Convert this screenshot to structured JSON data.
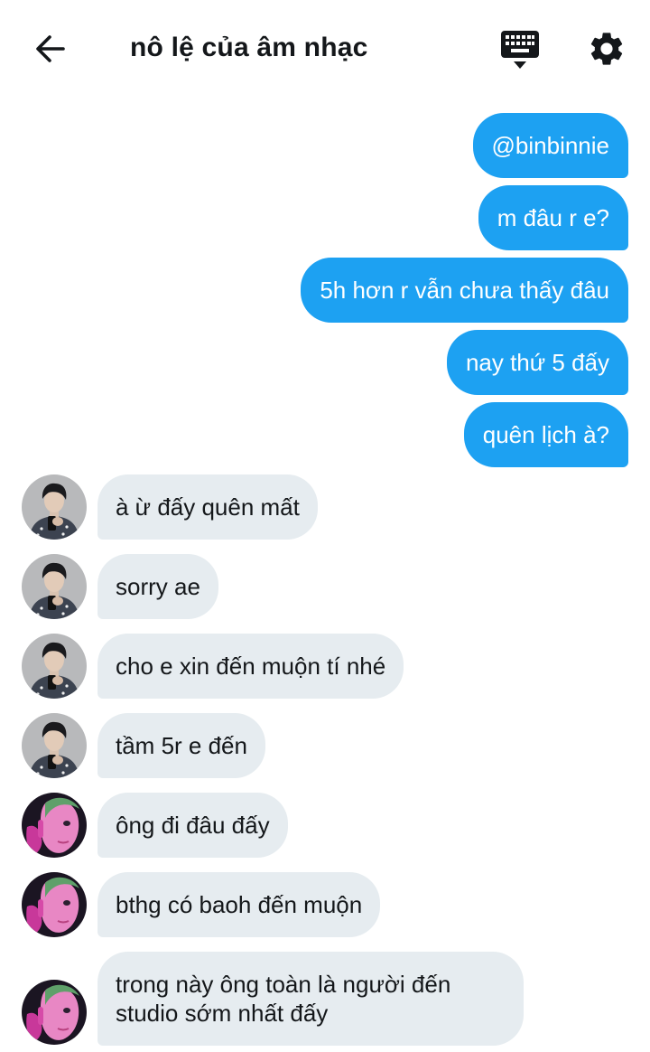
{
  "header": {
    "title": "nô lệ của âm nhạc"
  },
  "icons": {
    "back": "arrow-left-icon",
    "keyboard": "keyboard-icon",
    "settings": "gear-icon"
  },
  "colors": {
    "outgoing_bubble": "#1da1f2",
    "incoming_bubble": "#e6ecf0",
    "text": "#14171a"
  },
  "outgoing_messages": [
    "@binbinnie",
    "m đâu r e?",
    "5h hơn r vẫn chưa thấy đâu",
    "nay thứ 5 đấy",
    "quên lịch à?"
  ],
  "incoming_messages": [
    {
      "text": "à ừ đấy quên mất",
      "sender_avatar": "avatar-boy"
    },
    {
      "text": "sorry ae",
      "sender_avatar": "avatar-boy"
    },
    {
      "text": "cho e xin đến muộn tí nhé",
      "sender_avatar": "avatar-boy"
    },
    {
      "text": "tầm 5r e đến",
      "sender_avatar": "avatar-boy"
    },
    {
      "text": "ông đi đâu đấy",
      "sender_avatar": "avatar-pink"
    },
    {
      "text": "bthg có baoh đến muộn",
      "sender_avatar": "avatar-pink"
    },
    {
      "text": "trong này ông toàn là người đến studio sớm nhất đấy",
      "sender_avatar": "avatar-pink"
    }
  ]
}
